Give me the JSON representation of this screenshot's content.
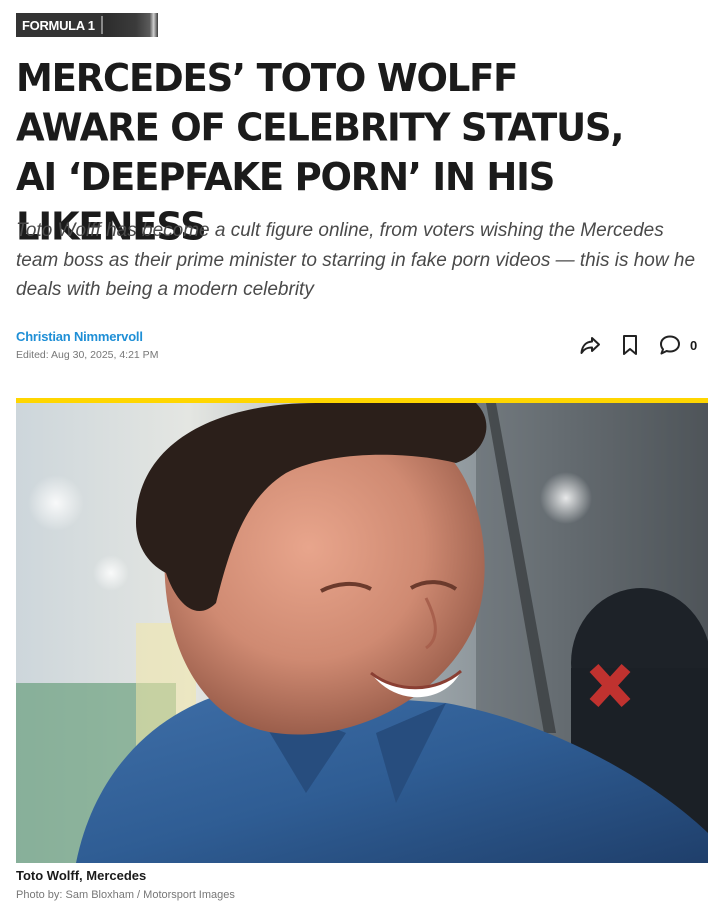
{
  "category": {
    "label": "FORMULA 1"
  },
  "article": {
    "headline": "MERCEDES’ TOTO WOLFF AWARE OF CELEBRITY STATUS, AI ‘DEEPFAKE PORN’ IN HIS LIKENESS",
    "subtitle": "Toto Wolff has become a cult figure online, from voters wishing the Mercedes team boss as their prime minister to starring in fake porn videos — this is how he deals with being a modern celebrity",
    "author": "Christian Nimmervoll",
    "edited": "Edited: Aug 30, 2025, 4:21 PM"
  },
  "actions": {
    "share_icon": "share-arrow-icon",
    "bookmark_icon": "bookmark-icon",
    "comment_icon": "speech-bubble-icon",
    "comment_count": "0"
  },
  "image": {
    "caption": "Toto Wolff, Mercedes",
    "credit": "Photo by: Sam Bloxham / Motorsport Images",
    "accent_color": "#ffd600"
  },
  "colors": {
    "author_link": "#1f8fd6",
    "badge_bg": "#333333"
  }
}
